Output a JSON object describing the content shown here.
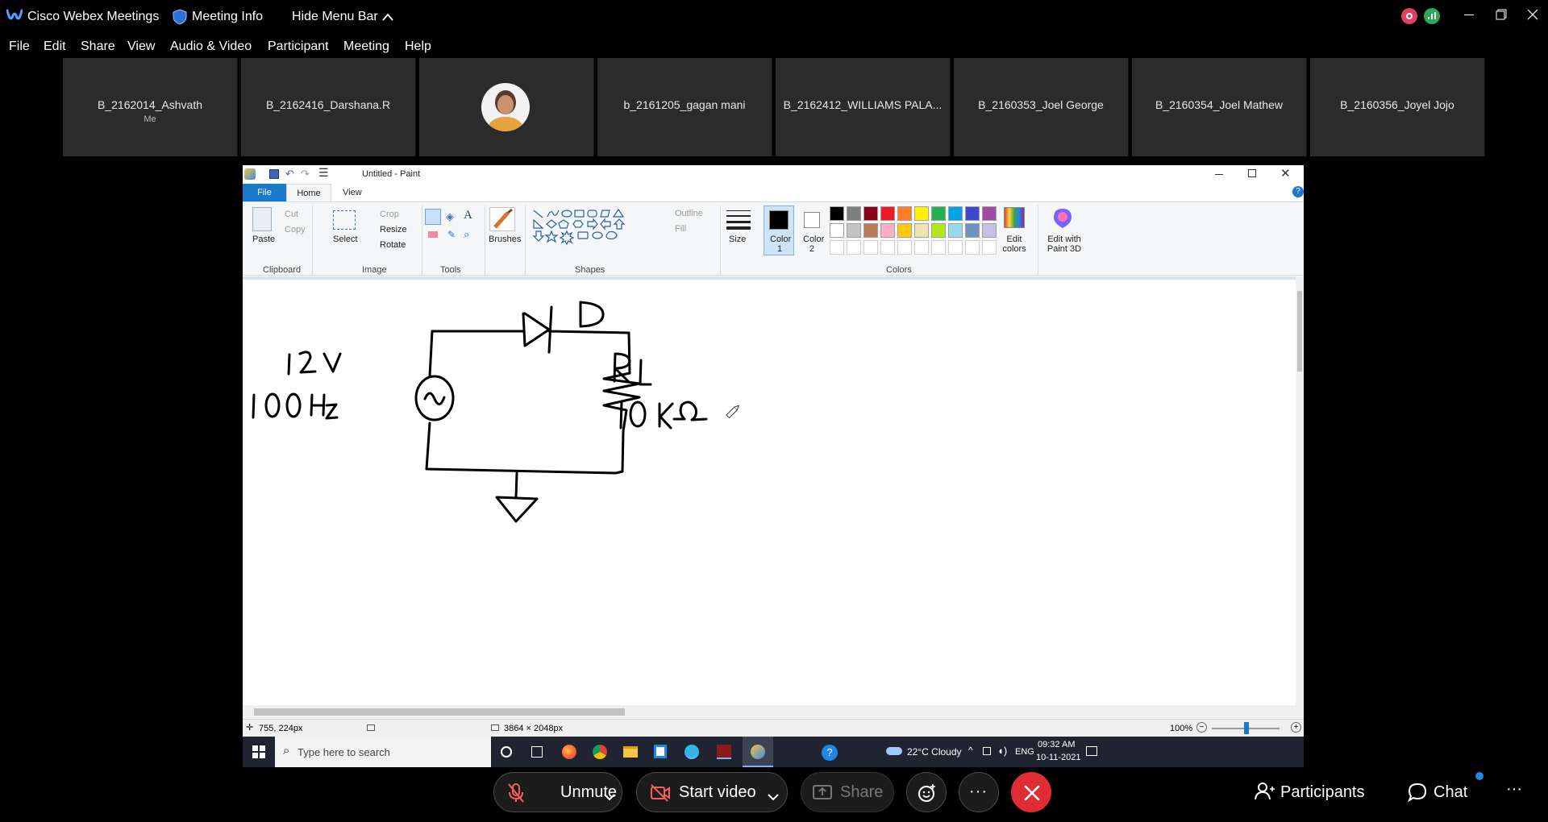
{
  "webex": {
    "app_title": "Cisco Webex Meetings",
    "meeting_info": "Meeting Info",
    "hide_menu_bar": "Hide Menu Bar",
    "menu": [
      "File",
      "Edit",
      "Share",
      "View",
      "Audio & Video",
      "Participant",
      "Meeting",
      "Help"
    ],
    "participants": [
      {
        "name": "B_2162014_Ashvath",
        "sub": "Me"
      },
      {
        "name": "B_2162416_Darshana.R",
        "sub": ""
      },
      {
        "name": "",
        "sub": "",
        "avatar": true
      },
      {
        "name": "b_2161205_gagan mani",
        "sub": ""
      },
      {
        "name": "B_2162412_WILLIAMS PALA...",
        "sub": ""
      },
      {
        "name": "B_2160353_Joel George",
        "sub": ""
      },
      {
        "name": "B_2160354_Joel Mathew",
        "sub": ""
      },
      {
        "name": "B_2160356_Joyel Jojo",
        "sub": ""
      }
    ],
    "controls": {
      "unmute": "Unmute",
      "start_video": "Start video",
      "share": "Share",
      "participants": "Participants",
      "chat": "Chat"
    }
  },
  "paint": {
    "window_title": "Untitled - Paint",
    "tabs": [
      "File",
      "Home",
      "View"
    ],
    "ribbon": {
      "paste": "Paste",
      "cut": "Cut",
      "copy": "Copy",
      "clipboard": "Clipboard",
      "select": "Select",
      "crop": "Crop",
      "resize": "Resize",
      "rotate": "Rotate",
      "image": "Image",
      "tools": "Tools",
      "brushes": "Brushes",
      "shapes": "Shapes",
      "outline": "Outline",
      "fill": "Fill",
      "size": "Size",
      "color1": "Color",
      "color1_num": "1",
      "color2": "Color",
      "color2_num": "2",
      "colors": "Colors",
      "edit_colors": "Edit colors",
      "edit_with_paint3d": "Edit with Paint 3D"
    },
    "palette_row1": [
      "#000000",
      "#7f7f7f",
      "#880015",
      "#ed1c24",
      "#ff7f27",
      "#fff200",
      "#22b14c",
      "#00a2e8",
      "#3f48cc",
      "#a349a4"
    ],
    "palette_row2": [
      "#ffffff",
      "#c3c3c3",
      "#b97a57",
      "#ffaec9",
      "#ffc90e",
      "#efe4b0",
      "#b5e61d",
      "#99d9ea",
      "#7092be",
      "#c8bfe7"
    ],
    "drawing": {
      "voltage": "12 V",
      "frequency": "100 Hz",
      "diode": "D",
      "resistor": "RL",
      "resistance": "10 KΩ"
    },
    "status": {
      "cursor_pos": "755, 224px",
      "image_size": "3864 × 2048px",
      "zoom": "100%"
    },
    "taskbar": {
      "search_placeholder": "Type here to search",
      "weather": "22°C  Cloudy",
      "lang": "ENG",
      "time": "09:32 AM",
      "date": "10-11-2021"
    }
  }
}
